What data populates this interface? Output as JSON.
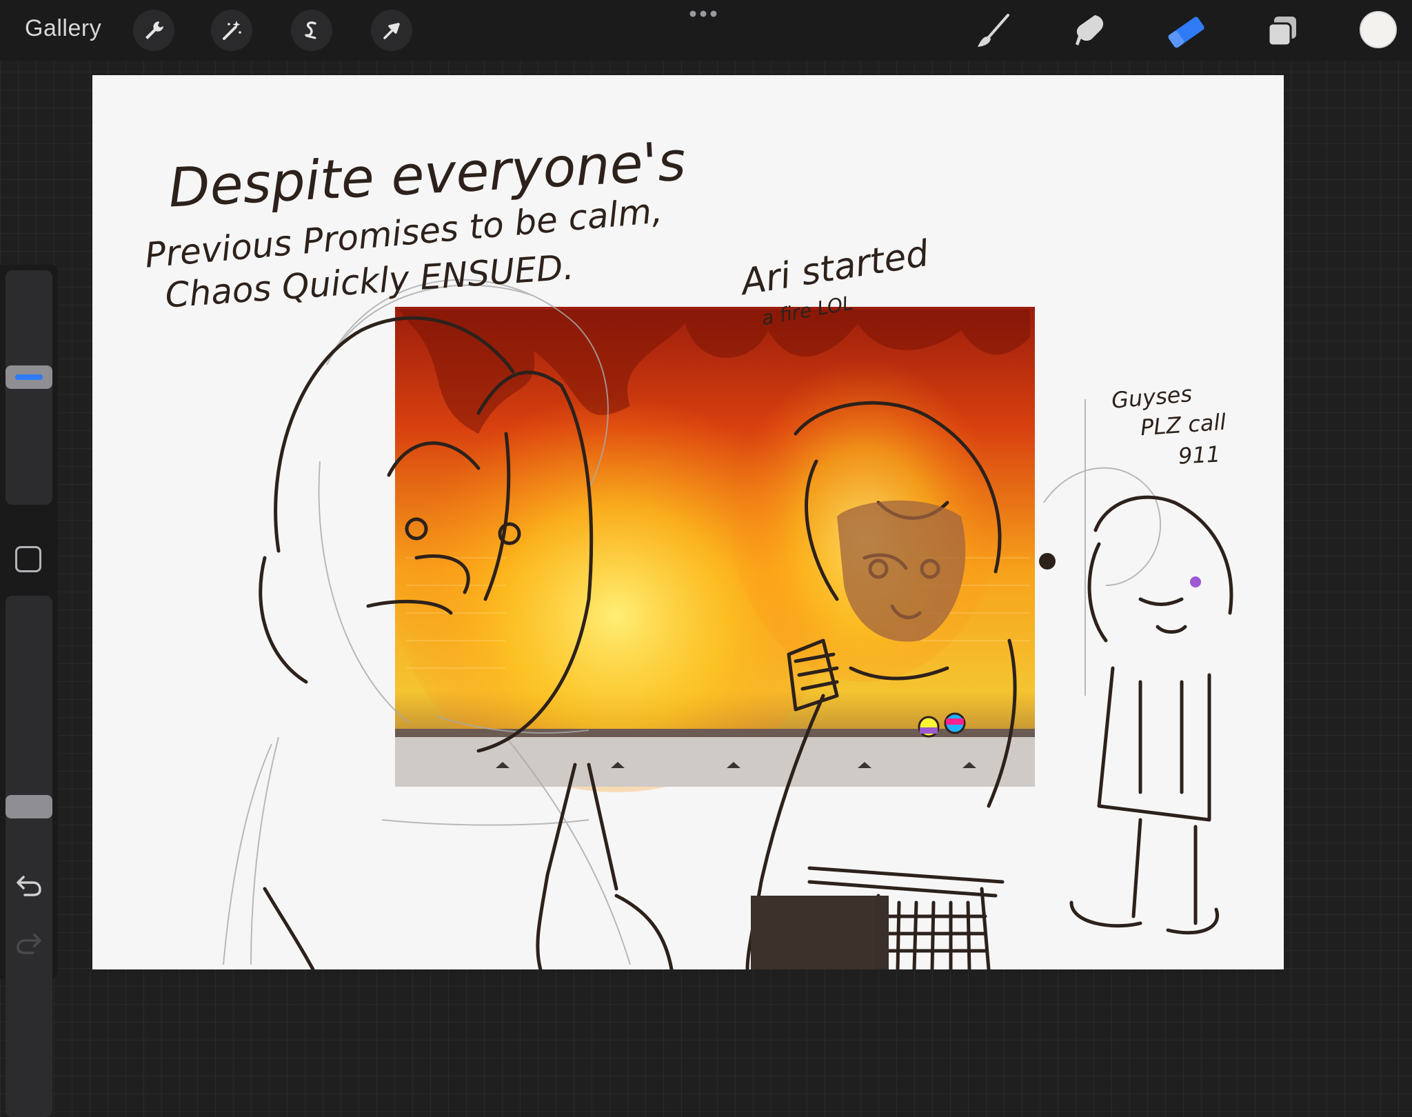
{
  "toolbar": {
    "gallery_label": "Gallery",
    "left_tools": [
      "wrench-icon",
      "magic-wand-icon",
      "selection-icon",
      "move-arrow-icon"
    ],
    "right_tools": [
      "brush-icon",
      "smudge-icon",
      "eraser-icon",
      "layers-icon"
    ],
    "active_tool": "eraser-icon",
    "active_color": "#f4f2ef",
    "accent_color": "#2f7bf6"
  },
  "sidebar": {
    "brush_size_level": 0.55,
    "opacity_level": 0.6,
    "controls": [
      "brush-size-slider",
      "modify-button",
      "opacity-slider",
      "undo-icon",
      "redo-icon"
    ]
  },
  "artwork": {
    "caption_line1": "Despite everyone's",
    "caption_line2": "Previous Promises to be calm,",
    "caption_line3": "Chaos Quickly ENSUED.",
    "note_center_line1": "Ari started",
    "note_center_line2": "a fire LOL",
    "note_right_line1": "Guyses",
    "note_right_line2": "PLZ call",
    "note_right_line3": "911"
  }
}
